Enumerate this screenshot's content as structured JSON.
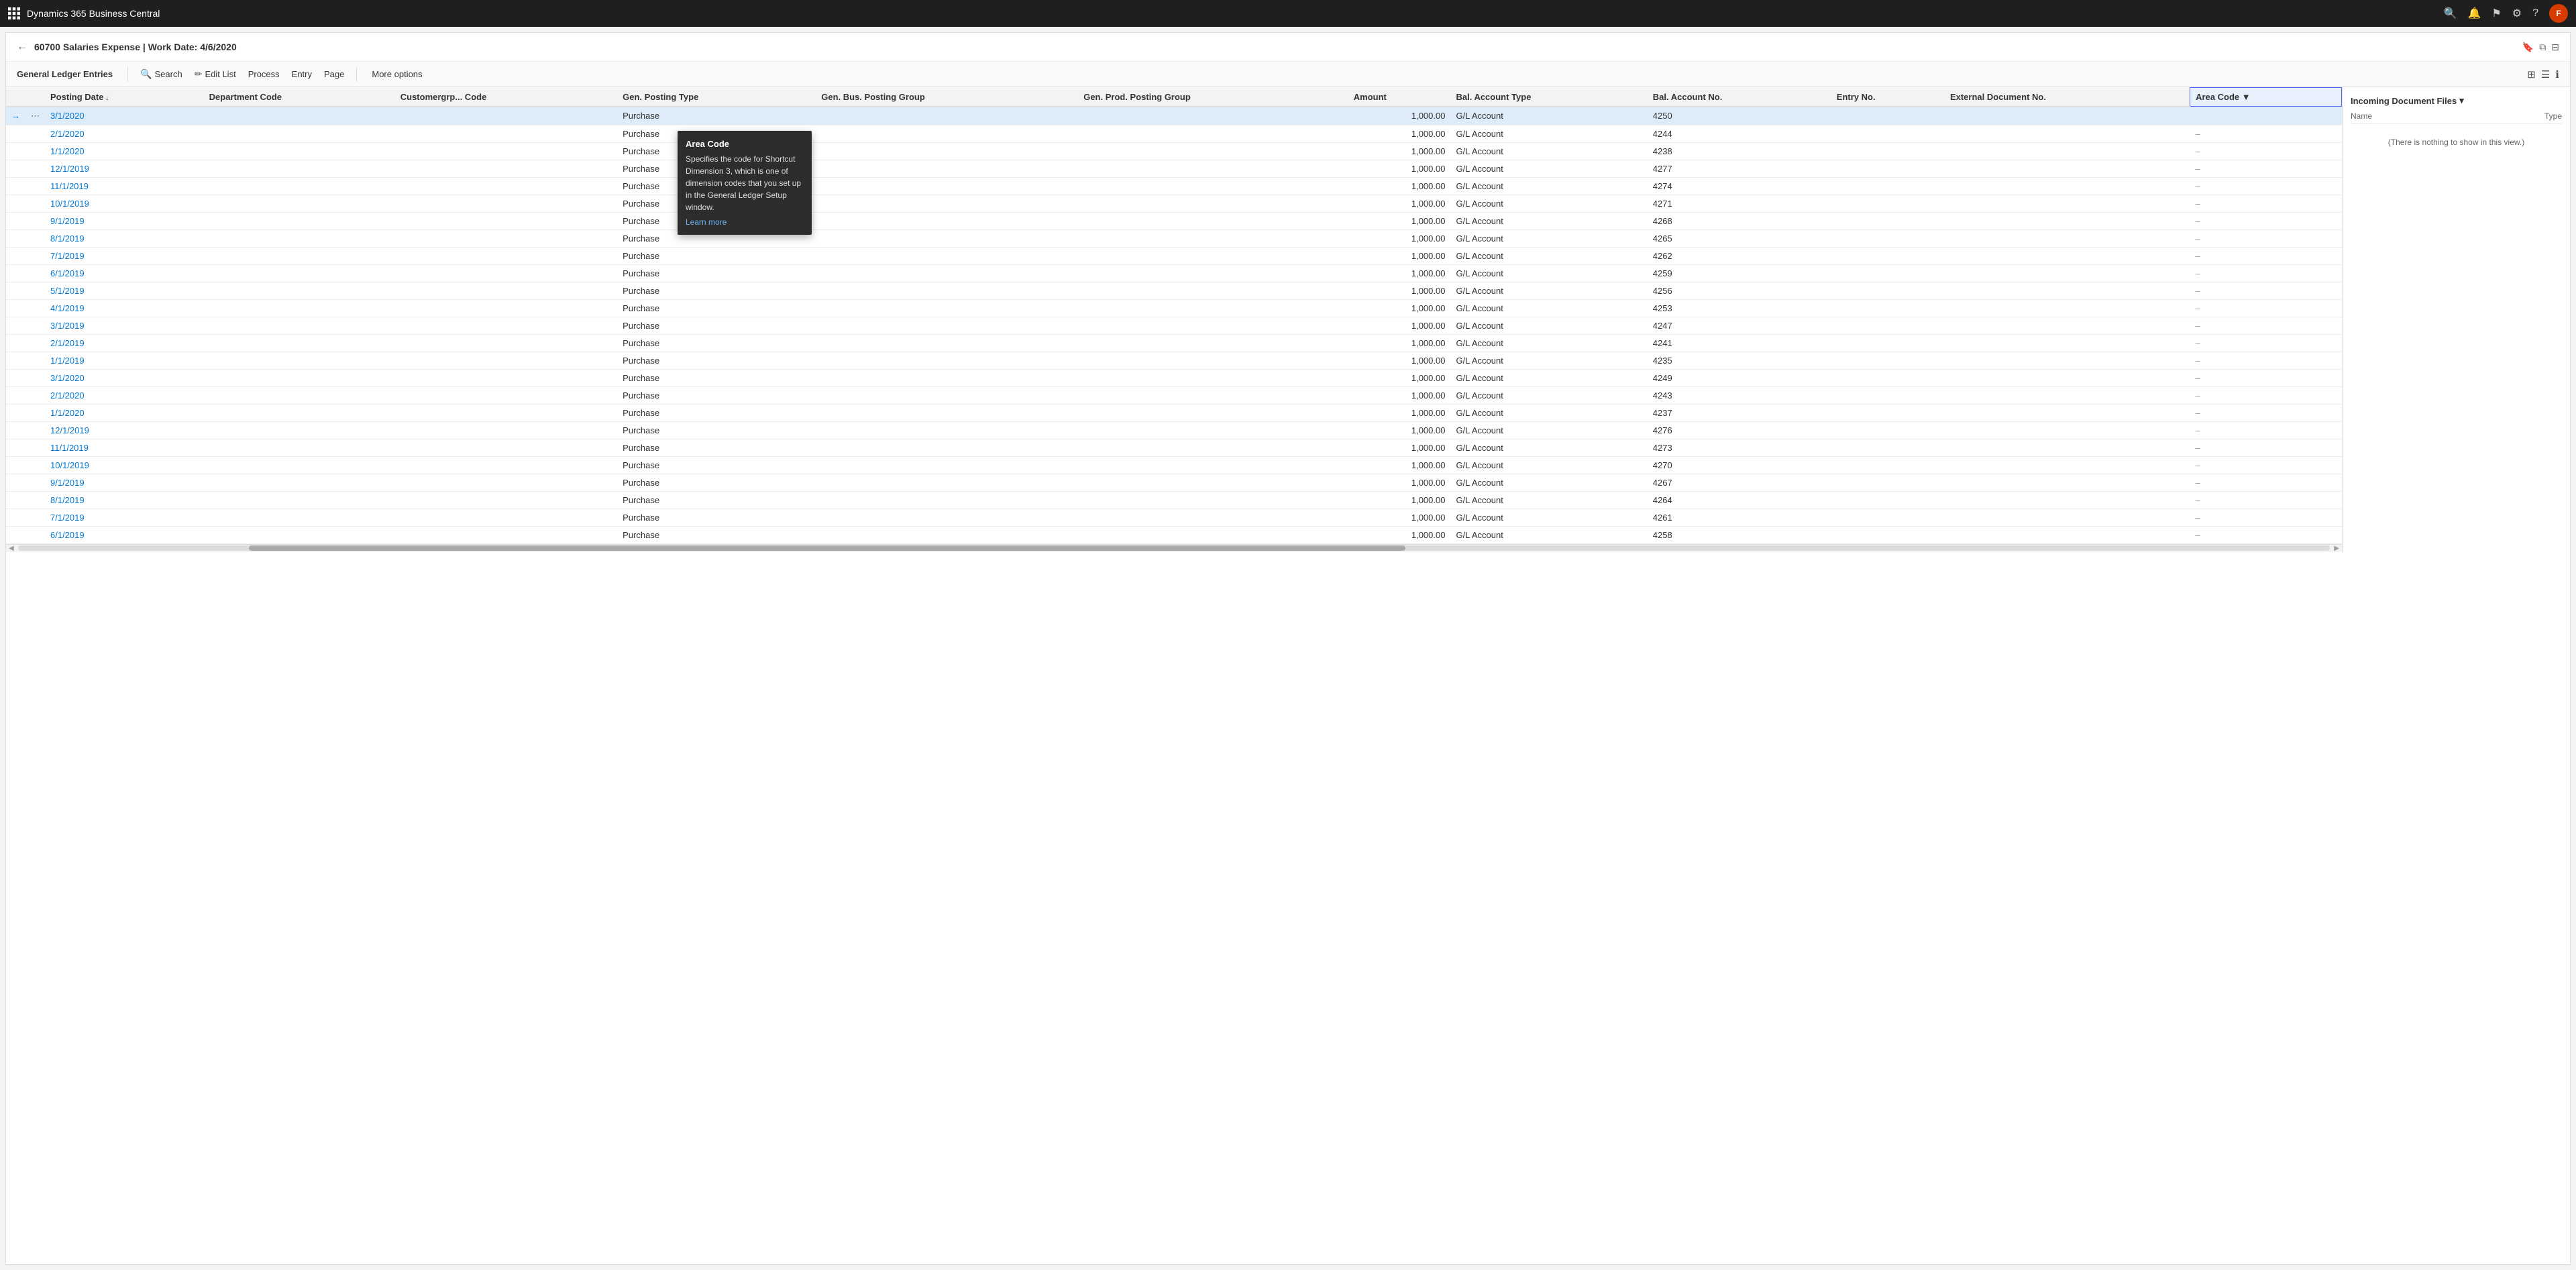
{
  "app": {
    "title": "Dynamics 365 Business Central"
  },
  "header": {
    "back_label": "←",
    "title": "60700 Salaries Expense | Work Date: 4/6/2020",
    "icons": {
      "bookmark": "🔖",
      "open_new": "⧉",
      "minimize": "⊟"
    }
  },
  "toolbar": {
    "section_title": "General Ledger Entries",
    "buttons": [
      {
        "id": "search",
        "label": "Search",
        "icon": "🔍"
      },
      {
        "id": "edit_list",
        "label": "Edit List",
        "icon": "✏️"
      },
      {
        "id": "process",
        "label": "Process"
      },
      {
        "id": "entry",
        "label": "Entry"
      },
      {
        "id": "page",
        "label": "Page"
      },
      {
        "id": "more_options",
        "label": "More options"
      }
    ],
    "right_icons": {
      "filter": "⊞",
      "list": "☰",
      "info": "ℹ"
    }
  },
  "table": {
    "columns": [
      {
        "id": "posting_date",
        "label": "Posting Date",
        "sortable": true
      },
      {
        "id": "dept_code",
        "label": "Department Code"
      },
      {
        "id": "customer_code",
        "label": "Customergrp... Code"
      },
      {
        "id": "gen_posting_type",
        "label": "Gen. Posting Type"
      },
      {
        "id": "gen_bus_posting_group",
        "label": "Gen. Bus. Posting Group"
      },
      {
        "id": "gen_prod_posting_group",
        "label": "Gen. Prod. Posting Group"
      },
      {
        "id": "amount",
        "label": "Amount"
      },
      {
        "id": "bal_account_type",
        "label": "Bal. Account Type"
      },
      {
        "id": "bal_account_no",
        "label": "Bal. Account No."
      },
      {
        "id": "entry_no",
        "label": "Entry No."
      },
      {
        "id": "external_doc_no",
        "label": "External Document No."
      },
      {
        "id": "area_code",
        "label": "Area Code",
        "highlighted": true
      }
    ],
    "rows": [
      {
        "posting_date": "3/1/2020",
        "gen_posting_type": "Purchase",
        "amount": "1,000.00",
        "bal_account_type": "G/L Account",
        "bal_account_no": "4250",
        "entry_no": "",
        "external_doc_no": "",
        "area_code": "",
        "selected": true
      },
      {
        "posting_date": "2/1/2020",
        "gen_posting_type": "Purchase",
        "amount": "1,000.00",
        "bal_account_type": "G/L Account",
        "bal_account_no": "4244",
        "entry_no": "",
        "external_doc_no": "",
        "area_code": "–"
      },
      {
        "posting_date": "1/1/2020",
        "gen_posting_type": "Purchase",
        "amount": "1,000.00",
        "bal_account_type": "G/L Account",
        "bal_account_no": "4238",
        "entry_no": "",
        "external_doc_no": "",
        "area_code": "–"
      },
      {
        "posting_date": "12/1/2019",
        "gen_posting_type": "Purchase",
        "amount": "1,000.00",
        "bal_account_type": "G/L Account",
        "bal_account_no": "4277",
        "entry_no": "",
        "external_doc_no": "",
        "area_code": "–"
      },
      {
        "posting_date": "11/1/2019",
        "gen_posting_type": "Purchase",
        "amount": "1,000.00",
        "bal_account_type": "G/L Account",
        "bal_account_no": "4274",
        "entry_no": "",
        "external_doc_no": "",
        "area_code": "–"
      },
      {
        "posting_date": "10/1/2019",
        "gen_posting_type": "Purchase",
        "amount": "1,000.00",
        "bal_account_type": "G/L Account",
        "bal_account_no": "4271",
        "entry_no": "",
        "external_doc_no": "",
        "area_code": "–"
      },
      {
        "posting_date": "9/1/2019",
        "gen_posting_type": "Purchase",
        "amount": "1,000.00",
        "bal_account_type": "G/L Account",
        "bal_account_no": "4268",
        "entry_no": "",
        "external_doc_no": "",
        "area_code": "–"
      },
      {
        "posting_date": "8/1/2019",
        "gen_posting_type": "Purchase",
        "amount": "1,000.00",
        "bal_account_type": "G/L Account",
        "bal_account_no": "4265",
        "entry_no": "",
        "external_doc_no": "",
        "area_code": "–"
      },
      {
        "posting_date": "7/1/2019",
        "gen_posting_type": "Purchase",
        "amount": "1,000.00",
        "bal_account_type": "G/L Account",
        "bal_account_no": "4262",
        "entry_no": "",
        "external_doc_no": "",
        "area_code": "–"
      },
      {
        "posting_date": "6/1/2019",
        "gen_posting_type": "Purchase",
        "amount": "1,000.00",
        "bal_account_type": "G/L Account",
        "bal_account_no": "4259",
        "entry_no": "",
        "external_doc_no": "",
        "area_code": "–"
      },
      {
        "posting_date": "5/1/2019",
        "gen_posting_type": "Purchase",
        "amount": "1,000.00",
        "bal_account_type": "G/L Account",
        "bal_account_no": "4256",
        "entry_no": "",
        "external_doc_no": "",
        "area_code": "–"
      },
      {
        "posting_date": "4/1/2019",
        "gen_posting_type": "Purchase",
        "amount": "1,000.00",
        "bal_account_type": "G/L Account",
        "bal_account_no": "4253",
        "entry_no": "",
        "external_doc_no": "",
        "area_code": "–"
      },
      {
        "posting_date": "3/1/2019",
        "gen_posting_type": "Purchase",
        "amount": "1,000.00",
        "bal_account_type": "G/L Account",
        "bal_account_no": "4247",
        "entry_no": "",
        "external_doc_no": "",
        "area_code": "–"
      },
      {
        "posting_date": "2/1/2019",
        "gen_posting_type": "Purchase",
        "amount": "1,000.00",
        "bal_account_type": "G/L Account",
        "bal_account_no": "4241",
        "entry_no": "",
        "external_doc_no": "",
        "area_code": "–"
      },
      {
        "posting_date": "1/1/2019",
        "gen_posting_type": "Purchase",
        "amount": "1,000.00",
        "bal_account_type": "G/L Account",
        "bal_account_no": "4235",
        "entry_no": "",
        "external_doc_no": "",
        "area_code": "–"
      },
      {
        "posting_date": "3/1/2020",
        "gen_posting_type": "Purchase",
        "amount": "1,000.00",
        "bal_account_type": "G/L Account",
        "bal_account_no": "4249",
        "entry_no": "",
        "external_doc_no": "",
        "area_code": "–"
      },
      {
        "posting_date": "2/1/2020",
        "gen_posting_type": "Purchase",
        "amount": "1,000.00",
        "bal_account_type": "G/L Account",
        "bal_account_no": "4243",
        "entry_no": "",
        "external_doc_no": "",
        "area_code": "–"
      },
      {
        "posting_date": "1/1/2020",
        "gen_posting_type": "Purchase",
        "amount": "1,000.00",
        "bal_account_type": "G/L Account",
        "bal_account_no": "4237",
        "entry_no": "",
        "external_doc_no": "",
        "area_code": "–"
      },
      {
        "posting_date": "12/1/2019",
        "gen_posting_type": "Purchase",
        "amount": "1,000.00",
        "bal_account_type": "G/L Account",
        "bal_account_no": "4276",
        "entry_no": "",
        "external_doc_no": "",
        "area_code": "–"
      },
      {
        "posting_date": "11/1/2019",
        "gen_posting_type": "Purchase",
        "amount": "1,000.00",
        "bal_account_type": "G/L Account",
        "bal_account_no": "4273",
        "entry_no": "",
        "external_doc_no": "",
        "area_code": "–"
      },
      {
        "posting_date": "10/1/2019",
        "gen_posting_type": "Purchase",
        "amount": "1,000.00",
        "bal_account_type": "G/L Account",
        "bal_account_no": "4270",
        "entry_no": "",
        "external_doc_no": "",
        "area_code": "–"
      },
      {
        "posting_date": "9/1/2019",
        "gen_posting_type": "Purchase",
        "amount": "1,000.00",
        "bal_account_type": "G/L Account",
        "bal_account_no": "4267",
        "entry_no": "",
        "external_doc_no": "",
        "area_code": "–"
      },
      {
        "posting_date": "8/1/2019",
        "gen_posting_type": "Purchase",
        "amount": "1,000.00",
        "bal_account_type": "G/L Account",
        "bal_account_no": "4264",
        "entry_no": "",
        "external_doc_no": "",
        "area_code": "–"
      },
      {
        "posting_date": "7/1/2019",
        "gen_posting_type": "Purchase",
        "amount": "1,000.00",
        "bal_account_type": "G/L Account",
        "bal_account_no": "4261",
        "entry_no": "",
        "external_doc_no": "",
        "area_code": "–"
      },
      {
        "posting_date": "6/1/2019",
        "gen_posting_type": "Purchase",
        "amount": "1,000.00",
        "bal_account_type": "G/L Account",
        "bal_account_no": "4258",
        "entry_no": "",
        "external_doc_no": "",
        "area_code": "–"
      }
    ]
  },
  "tooltip": {
    "title": "Area Code",
    "text": "Specifies the code for Shortcut Dimension 3, which is one of dimension codes that you set up in the General Ledger Setup window.",
    "link_label": "Learn more"
  },
  "right_panel": {
    "title": "Incoming Document Files",
    "columns": {
      "name": "Name",
      "type": "Type"
    },
    "empty_message": "(There is nothing to show in this view.)"
  },
  "nav": {
    "grid_icon": "⊞",
    "search_icon": "🔍",
    "bell_icon": "🔔",
    "flag_icon": "⚑",
    "settings_icon": "⚙",
    "help_icon": "?",
    "user_initials": "F"
  }
}
